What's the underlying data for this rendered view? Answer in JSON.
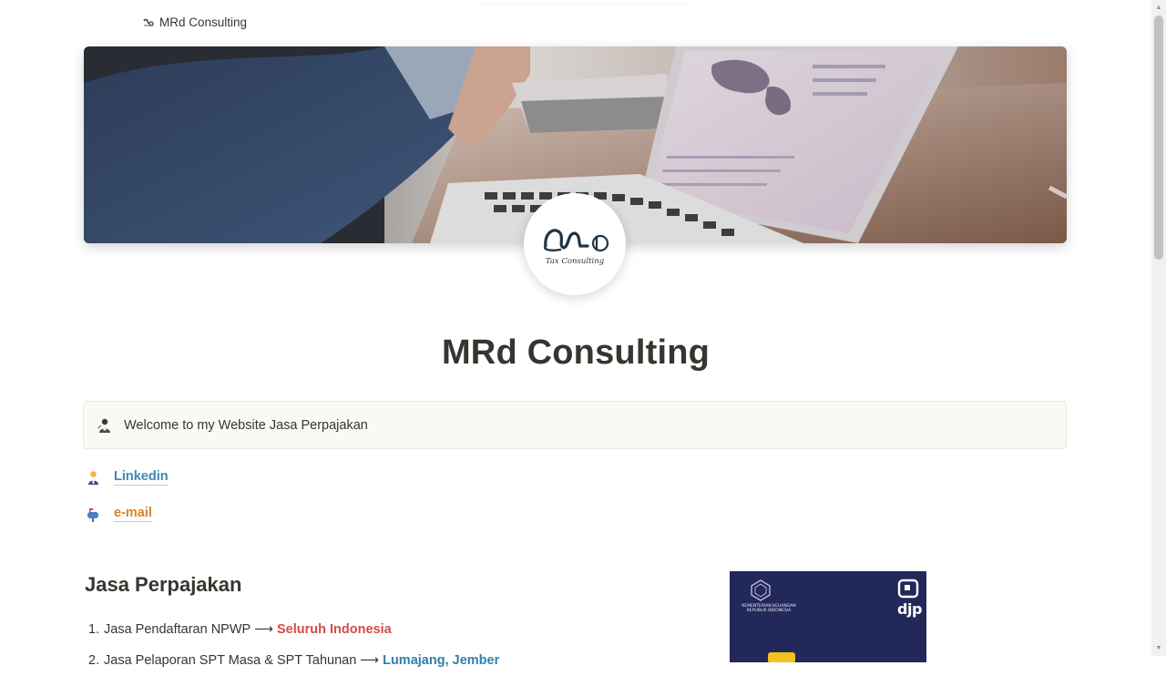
{
  "header": {
    "breadcrumb_label": "MRd Consulting"
  },
  "logo": {
    "tagline": "Tax Consulting"
  },
  "page": {
    "title": "MRd Consulting"
  },
  "callout": {
    "icon": "teacher-emoji-icon",
    "text": "Welcome to my Website Jasa Perpajakan"
  },
  "links": [
    {
      "icon": "person-emoji-icon",
      "label": "Linkedin"
    },
    {
      "icon": "mailbox-emoji-icon",
      "label": "e-mail"
    }
  ],
  "services": {
    "heading": "Jasa Perpajakan",
    "items": [
      {
        "num": "1.",
        "text": "Jasa Pendaftaran NPWP",
        "arrow": "⟶",
        "highlight": "Seluruh Indonesia"
      },
      {
        "num": "2.",
        "text": "Jasa Pelaporan SPT Masa & SPT Tahunan",
        "arrow": "⟶",
        "highlight": "Lumajang, Jember"
      }
    ]
  },
  "djp_card": {
    "ministry_text": "KEMENTERIAN KEUANGAN REPUBLIK INDONESIA",
    "brand": "djp"
  },
  "colors": {
    "link_blue": "#3b8ab0",
    "link_orange": "#d9822b",
    "highlight_red": "#d44c47",
    "highlight_blue": "#337ea9",
    "callout_bg": "#fbf9f6",
    "djp_navy": "#23285b"
  }
}
